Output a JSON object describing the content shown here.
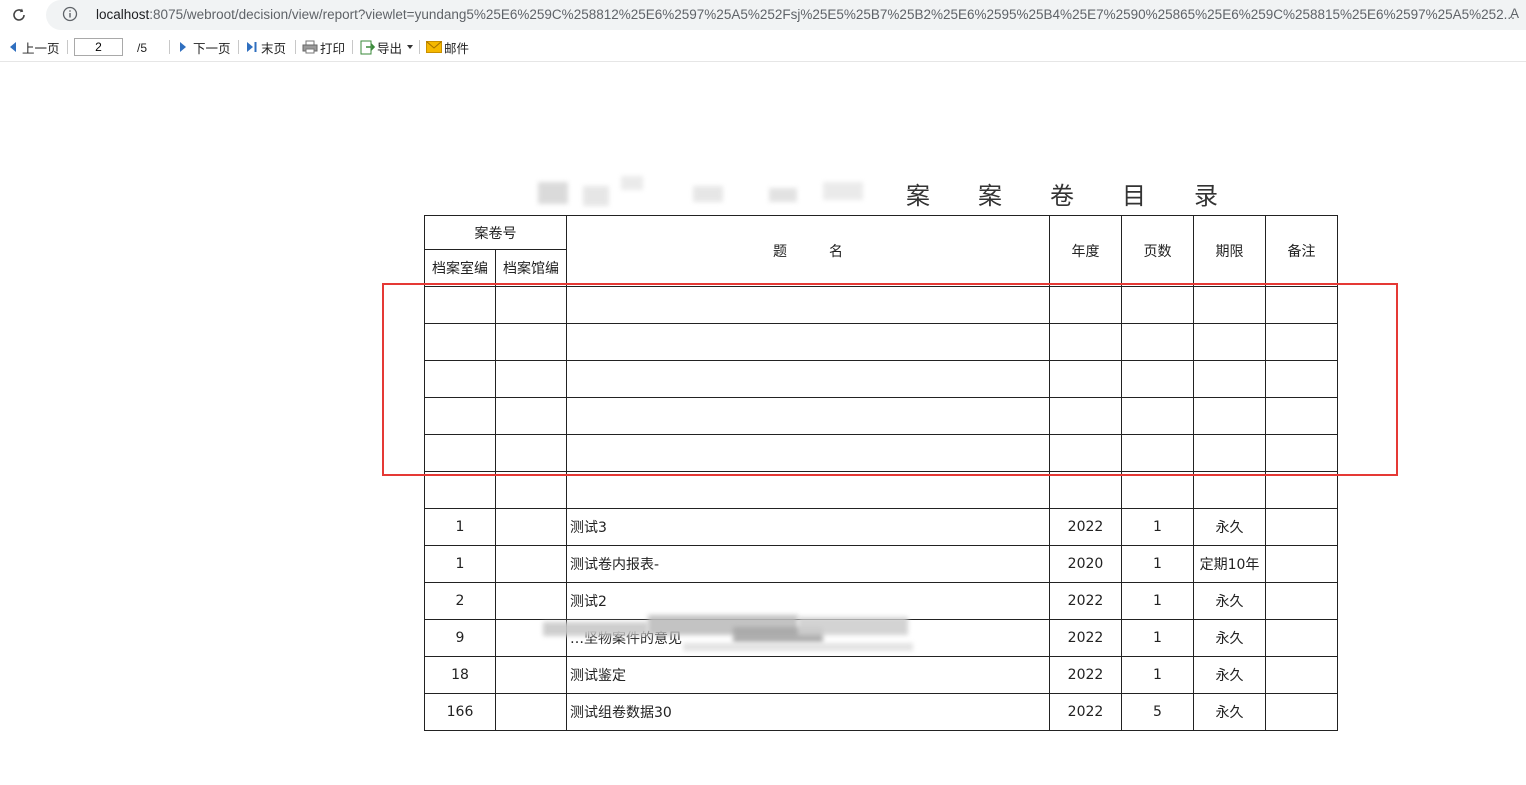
{
  "browser": {
    "url_host": "localhost",
    "url_rest": ":8075/webroot/decision/view/report?viewlet=yundang5%25E6%259C%258812%25E6%2597%25A5%252Fsj%25E5%25B7%25B2%25E6%2595%25B4%25E7%2590%25865%25E6%259C%258815%25E6%2597%25A5%252...",
    "overflow_letter": "A"
  },
  "toolbar": {
    "prev_label": "上一页",
    "page_value": "2",
    "page_total": "/5",
    "next_label": "下一页",
    "last_label": "末页",
    "print_label": "打印",
    "export_label": "导出",
    "mail_label": "邮件"
  },
  "report": {
    "title_visible_chars": [
      "案",
      "案",
      "卷",
      "目",
      "录"
    ],
    "headers": {
      "case_no": "案卷号",
      "room_no": "档案室编",
      "hall_no": "档案馆编",
      "title": "题　　　名",
      "year": "年度",
      "pages": "页数",
      "term": "期限",
      "remark": "备注"
    },
    "rows": [
      {
        "room": "",
        "hall": "",
        "title": "",
        "year": "",
        "pages": "",
        "term": "",
        "remark": ""
      },
      {
        "room": "",
        "hall": "",
        "title": "",
        "year": "",
        "pages": "",
        "term": "",
        "remark": ""
      },
      {
        "room": "",
        "hall": "",
        "title": "",
        "year": "",
        "pages": "",
        "term": "",
        "remark": ""
      },
      {
        "room": "",
        "hall": "",
        "title": "",
        "year": "",
        "pages": "",
        "term": "",
        "remark": ""
      },
      {
        "room": "",
        "hall": "",
        "title": "",
        "year": "",
        "pages": "",
        "term": "",
        "remark": ""
      },
      {
        "room": "",
        "hall": "",
        "title": "",
        "year": "",
        "pages": "",
        "term": "",
        "remark": ""
      },
      {
        "room": "1",
        "hall": "",
        "title": "测试3",
        "year": "2022",
        "pages": "1",
        "term": "永久",
        "remark": ""
      },
      {
        "room": "1",
        "hall": "",
        "title": "测试卷内报表-",
        "year": "2020",
        "pages": "1",
        "term": "定期10年",
        "remark": ""
      },
      {
        "room": "2",
        "hall": "",
        "title": "测试2",
        "year": "2022",
        "pages": "1",
        "term": "永久",
        "remark": ""
      },
      {
        "room": "9",
        "hall": "",
        "title": "…坚物案件的意见",
        "year": "2022",
        "pages": "1",
        "term": "永久",
        "remark": ""
      },
      {
        "room": "18",
        "hall": "",
        "title": "测试鉴定",
        "year": "2022",
        "pages": "1",
        "term": "永久",
        "remark": ""
      },
      {
        "room": "166",
        "hall": "",
        "title": "测试组卷数据30",
        "year": "2022",
        "pages": "5",
        "term": "永久",
        "remark": ""
      }
    ]
  },
  "colors": {
    "highlight": "#e53935",
    "toolbar_icon": "#2f6fbf",
    "mail_icon": "#e8a200"
  }
}
